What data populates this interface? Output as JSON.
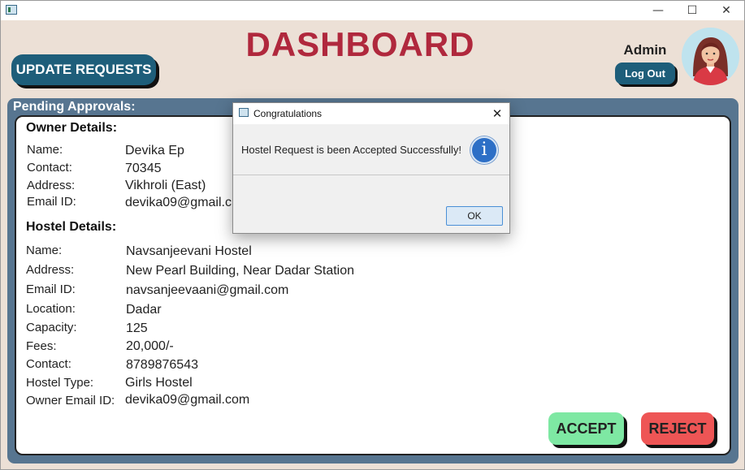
{
  "window": {
    "minimize_glyph": "—",
    "maximize_glyph": "☐",
    "close_glyph": "✕"
  },
  "header": {
    "update_requests_label": "UPDATE REQUESTS",
    "title": "DASHBOARD",
    "admin_label": "Admin",
    "logout_label": "Log Out",
    "avatar_icon": "woman-avatar-icon"
  },
  "pending": {
    "label": "Pending Approvals:",
    "owner": {
      "heading": "Owner Details:",
      "fields": [
        {
          "label": "Name:",
          "value": "Devika Ep"
        },
        {
          "label": "Contact:",
          "value": "70345"
        },
        {
          "label": "Address:",
          "value": "Vikhroli (East)"
        },
        {
          "label": "Email ID:",
          "value": "devika09@gmail.c"
        }
      ]
    },
    "hostel": {
      "heading": "Hostel Details:",
      "fields": [
        {
          "label": "Name:",
          "value": "Navsanjeevani Hostel"
        },
        {
          "label": "Address:",
          "value": "New Pearl Building, Near Dadar Station"
        },
        {
          "label": "Email ID:",
          "value": "navsanjeevaani@gmail.com"
        },
        {
          "label": "Location:",
          "value": "Dadar"
        },
        {
          "label": "Capacity:",
          "value": "125"
        },
        {
          "label": "Fees:",
          "value": "20,000/-"
        },
        {
          "label": "Contact:",
          "value": "8789876543"
        },
        {
          "label": "Hostel Type:",
          "value": "Girls Hostel"
        },
        {
          "label": "Owner Email ID:",
          "value": "devika09@gmail.com"
        }
      ]
    },
    "accept_label": "ACCEPT",
    "reject_label": "REJECT"
  },
  "dialog": {
    "title": "Congratulations",
    "close_glyph": "✕",
    "message": "Hostel Request is been Accepted Successfully!",
    "info_glyph": "i",
    "ok_label": "OK"
  },
  "colors": {
    "background": "#ece0d6",
    "title_red": "#b0283d",
    "button_teal": "#1e5e7a",
    "panel_blue": "#577590",
    "accept_green": "#7ee8a3",
    "reject_red": "#ee5555",
    "info_blue": "#2d6fc6"
  }
}
